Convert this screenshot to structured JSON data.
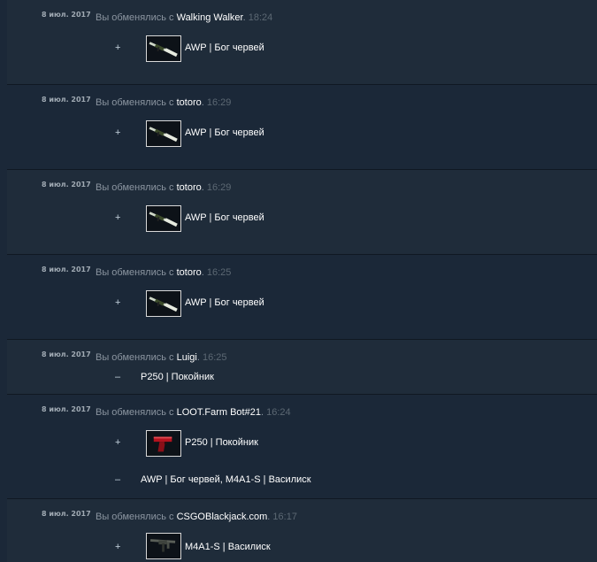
{
  "trades": [
    {
      "date": "8 июл. 2017",
      "prefix": "Вы обменялись с ",
      "partner": "Walking Walker",
      "sep": ". ",
      "time": "18:24",
      "received": {
        "sign": "+",
        "icon": "awp-rifle-icon",
        "name": "AWP | Бог червей"
      }
    },
    {
      "date": "8 июл. 2017",
      "prefix": "Вы обменялись с ",
      "partner": "totoro",
      "sep": ". ",
      "time": "16:29",
      "received": {
        "sign": "+",
        "icon": "awp-rifle-icon",
        "name": "AWP | Бог червей"
      }
    },
    {
      "date": "8 июл. 2017",
      "prefix": "Вы обменялись с ",
      "partner": "totoro",
      "sep": ". ",
      "time": "16:29",
      "received": {
        "sign": "+",
        "icon": "awp-rifle-icon",
        "name": "AWP | Бог червей"
      }
    },
    {
      "date": "8 июл. 2017",
      "prefix": "Вы обменялись с ",
      "partner": "totoro",
      "sep": ". ",
      "time": "16:25",
      "received": {
        "sign": "+",
        "icon": "awp-rifle-icon",
        "name": "AWP | Бог червей"
      }
    },
    {
      "date": "8 июл. 2017",
      "prefix": "Вы обменялись с ",
      "partner": "Luigi",
      "sep": ". ",
      "time": "16:25",
      "given": {
        "sign": "–",
        "name": "P250 | Покойник"
      }
    },
    {
      "date": "8 июл. 2017",
      "prefix": "Вы обменялись с ",
      "partner": "LOOT.Farm Bot#21",
      "sep": ". ",
      "time": "16:24",
      "received": {
        "sign": "+",
        "icon": "p250-pistol-icon",
        "name": "P250 | Покойник"
      },
      "given": {
        "sign": "–",
        "name": "AWP | Бог червей, M4A1-S | Василиск"
      }
    },
    {
      "date": "8 июл. 2017",
      "prefix": "Вы обменялись с ",
      "partner": "CSGOBlackjack.com",
      "sep": ". ",
      "time": "16:17",
      "received": {
        "sign": "+",
        "icon": "m4a1s-rifle-icon",
        "name": "M4A1-S | Василиск"
      }
    }
  ]
}
